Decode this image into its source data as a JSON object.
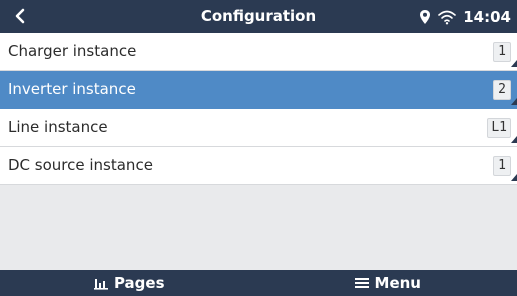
{
  "header": {
    "title": "Configuration",
    "time": "14:04"
  },
  "rows": [
    {
      "label": "Charger instance",
      "value": "1",
      "selected": false
    },
    {
      "label": "Inverter instance",
      "value": "2",
      "selected": true
    },
    {
      "label": "Line instance",
      "value": "L1",
      "selected": false
    },
    {
      "label": "DC source instance",
      "value": "1",
      "selected": false
    }
  ],
  "footer": {
    "pages_label": "Pages",
    "menu_label": "Menu"
  },
  "colors": {
    "header_bg": "#2b3a52",
    "selection": "#4f8ac6",
    "background": "#e9eaec"
  },
  "icons": {
    "back": "chevron-left-icon",
    "location": "location-pin-icon",
    "wifi": "wifi-icon",
    "pages": "bar-chart-icon",
    "menu": "hamburger-menu-icon"
  }
}
